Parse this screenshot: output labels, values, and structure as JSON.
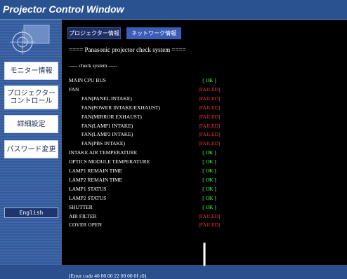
{
  "window": {
    "title": "Projector Control Window"
  },
  "sidebar": {
    "items": [
      {
        "label": "モニター情報"
      },
      {
        "label": "プロジェクター\nコントロール"
      },
      {
        "label": "詳細設定"
      },
      {
        "label": "パスワード変更"
      }
    ],
    "language_button": "English"
  },
  "tabs": [
    {
      "label": "プロジェクター情報",
      "active": true
    },
    {
      "label": "ネットワーク情報",
      "active": false
    }
  ],
  "check": {
    "header": "==== Panasonic projector check system ====",
    "subheader": "----- check system -----",
    "items": [
      {
        "label": "MAIN CPU BUS",
        "status": "[ OK ]",
        "state": "ok",
        "indent": false
      },
      {
        "label": "FAN",
        "status": "[FAILED]",
        "state": "failed",
        "indent": false
      },
      {
        "label": "FAN(PANEL INTAKE)",
        "status": "[FAILED]",
        "state": "failed",
        "indent": true
      },
      {
        "label": "FAN(POWER INTAKE/EXHAUST)",
        "status": "[FAILED]",
        "state": "failed",
        "indent": true
      },
      {
        "label": "FAN(MIRROR EXHAUST)",
        "status": "[FAILED]",
        "state": "failed",
        "indent": true
      },
      {
        "label": "FAN(LAMP1 INTAKE)",
        "status": "[FAILED]",
        "state": "failed",
        "indent": true
      },
      {
        "label": "FAN(LAMP2 INTAKE)",
        "status": "[FAILED]",
        "state": "failed",
        "indent": true
      },
      {
        "label": "FAN(PBS INTAKE)",
        "status": "[FAILED]",
        "state": "failed",
        "indent": true
      },
      {
        "label": "INTAKE AIR TEMPERATURE",
        "status": "[ OK ]",
        "state": "ok",
        "indent": false
      },
      {
        "label": "OPTICS MODULE TEMPERATURE",
        "status": "[ OK ]",
        "state": "ok",
        "indent": false
      },
      {
        "label": "LAMP1 REMAIN TIME",
        "status": "[ OK ]",
        "state": "ok",
        "indent": false
      },
      {
        "label": "LAMP2 REMAIN TIME",
        "status": "[ OK ]",
        "state": "ok",
        "indent": false
      },
      {
        "label": "LAMP1 STATUS",
        "status": "[ OK ]",
        "state": "ok",
        "indent": false
      },
      {
        "label": "LAMP2 STATUS",
        "status": "[ OK ]",
        "state": "ok",
        "indent": false
      },
      {
        "label": "SHUTTER",
        "status": "[ OK ]",
        "state": "ok",
        "indent": false
      },
      {
        "label": "AIR FILTER",
        "status": "[FAILED]",
        "state": "failed",
        "indent": false
      },
      {
        "label": "COVER OPEN",
        "status": "[FAILED]",
        "state": "failed",
        "indent": false
      }
    ],
    "error_code": "(Error code 40 00 00 22 00 00 0f c0)"
  },
  "colors": {
    "ok": "#4bff4b",
    "failed": "#ff2a2a",
    "accent": "#2a5190"
  },
  "icons": {
    "logo": "projector-lens-icon"
  }
}
